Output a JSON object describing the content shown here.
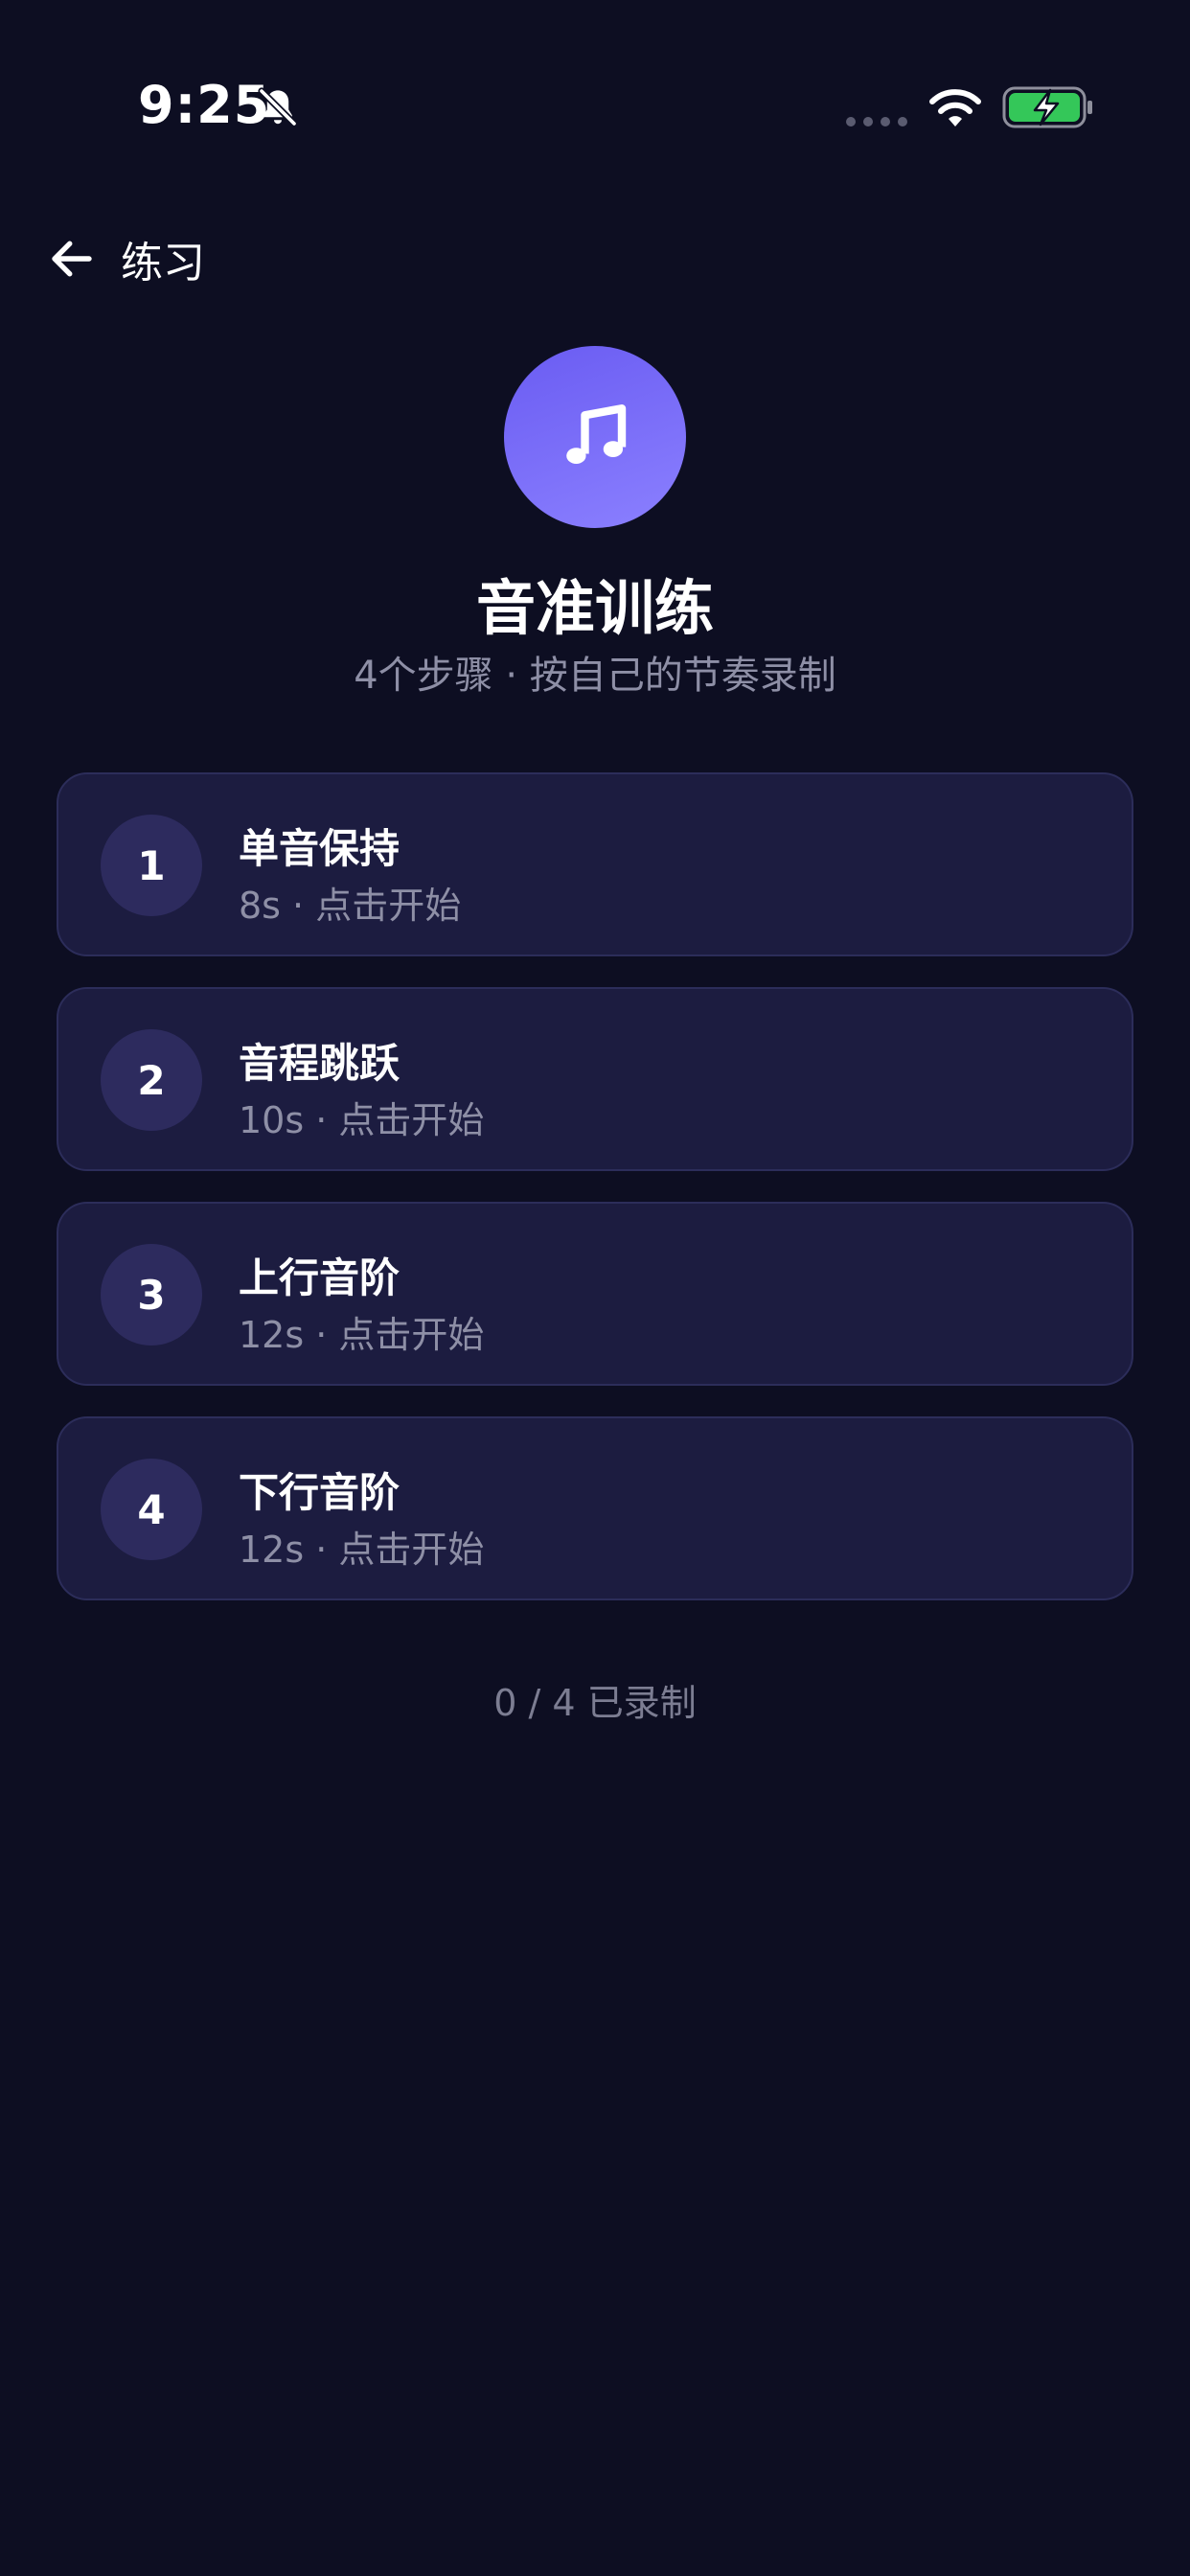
{
  "status_bar": {
    "time": "9:25",
    "icons": [
      "bell-slash-icon",
      "signal-icon",
      "wifi-icon",
      "battery-charging-icon"
    ],
    "battery_color": "#34c759"
  },
  "nav": {
    "back_label": "练习",
    "back_icon": "arrow-left-icon"
  },
  "hero": {
    "icon": "music-note-icon",
    "accent": "#7b6cf6",
    "title": "音准训练",
    "subtitle": "4个步骤 · 按自己的节奏录制"
  },
  "steps": [
    {
      "number": "1",
      "title": "单音保持",
      "meta": "8s · 点击开始"
    },
    {
      "number": "2",
      "title": "音程跳跃",
      "meta": "10s · 点击开始"
    },
    {
      "number": "3",
      "title": "上行音阶",
      "meta": "12s · 点击开始"
    },
    {
      "number": "4",
      "title": "下行音阶",
      "meta": "12s · 点击开始"
    }
  ],
  "progress": {
    "text": "0 / 4 已录制"
  }
}
